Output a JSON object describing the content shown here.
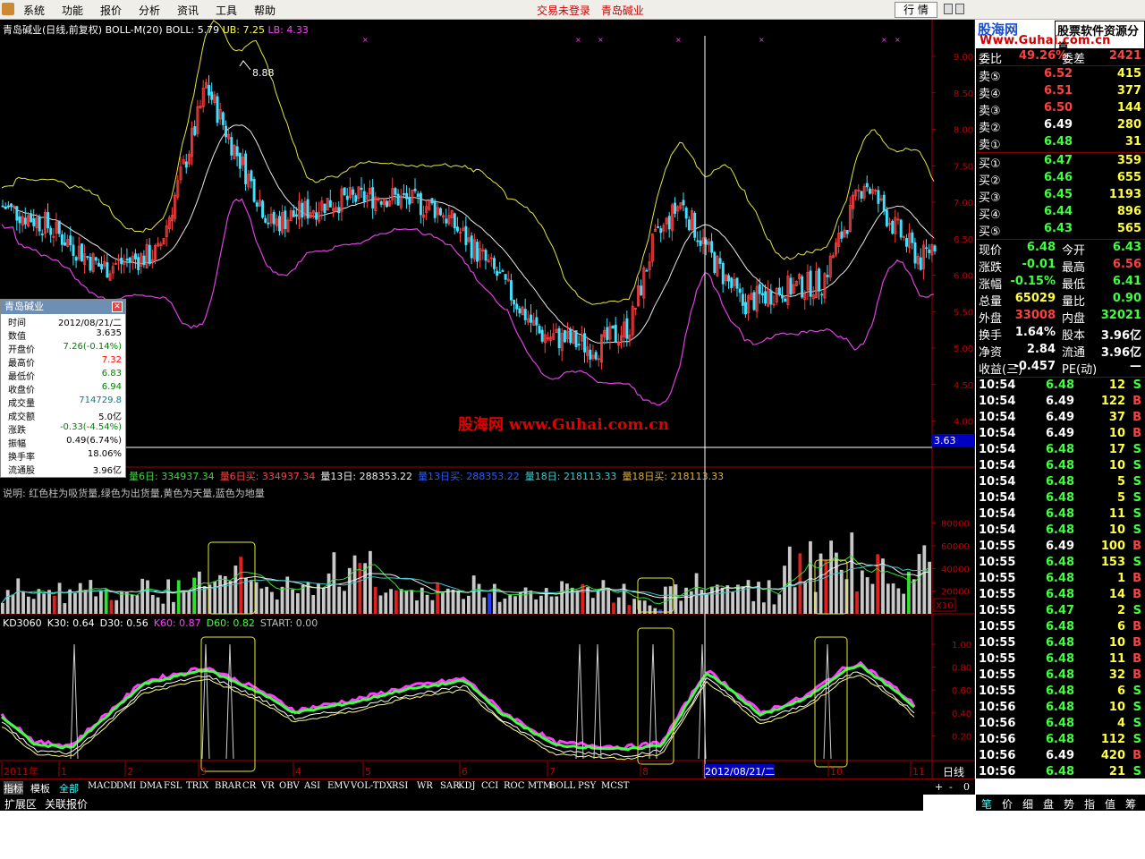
{
  "menu": [
    "系统",
    "功能",
    "报价",
    "分析",
    "资讯",
    "工具",
    "帮助"
  ],
  "center_notice": [
    "交易未登录",
    "青岛碱业"
  ],
  "quote_button": "行 情",
  "main_header": {
    "name": "青岛碱业(日线,前复权)",
    "indicator": "BOLL-M(20)",
    "boll": "BOLL: 5.79",
    "ub": "UB: 7.25",
    "lb": "LB: 4.33"
  },
  "y_axis_price": [
    "9.00",
    "8.50",
    "8.00",
    "7.50",
    "7.00",
    "6.50",
    "6.00",
    "5.50",
    "5.00",
    "4.50",
    "4.00"
  ],
  "crosshair_price": "3.63",
  "max_label": "8.88",
  "watermark": "股海网  www.Guhai.com.cn",
  "volume_header": [
    {
      "text": "量6日: 334937.34",
      "color": "#46d246"
    },
    {
      "text": "量6日买: 334937.34",
      "color": "#ff4040"
    },
    {
      "text": "量13日: 288353.22",
      "color": "#f0f0f0"
    },
    {
      "text": "量13日买: 288353.22",
      "color": "#2a5bff"
    },
    {
      "text": "量18日: 218113.33",
      "color": "#3fc7c7"
    },
    {
      "text": "量18日买: 218113.33",
      "color": "#e0b040"
    }
  ],
  "volume_note": "说明: 红色柱为吸货量,绿色为出货量,黄色为天量,蓝色为地量",
  "y_axis_volume": [
    "80000",
    "60000",
    "40000",
    "20000"
  ],
  "volume_unit": "X10",
  "kd_header": [
    {
      "text": "KD3060",
      "color": "#ffffff"
    },
    {
      "text": "K30: 0.64",
      "color": "#ffffff"
    },
    {
      "text": "D30: 0.56",
      "color": "#ffffff"
    },
    {
      "text": "K60: 0.87",
      "color": "#ff40ff"
    },
    {
      "text": "D60: 0.82",
      "color": "#40ff40"
    },
    {
      "text": "START: 0.00",
      "color": "#c0c0c0"
    }
  ],
  "y_axis_kd": [
    "1.00",
    "0.80",
    "0.60",
    "0.40",
    "0.20"
  ],
  "date_axis": [
    "2011年",
    "1",
    "2",
    "3",
    "4",
    "5",
    "6",
    "7",
    "8",
    "2012/08/21/二",
    "10",
    "11"
  ],
  "period": "日线",
  "tab_controls": [
    "+",
    "-",
    "0"
  ],
  "indicator_tabs": [
    "指标",
    "模板",
    "全部",
    "MACD",
    "DMI",
    "DMA",
    "FSL",
    "TRIX",
    "BRAR",
    "CR",
    "VR",
    "OBV",
    "ASI",
    "EMV",
    "VOL-TDX",
    "RSI",
    "WR",
    "SAR",
    "KDJ",
    "CCI",
    "ROC",
    "MTM",
    "BOLL",
    "PSY",
    "MCST"
  ],
  "bottom_tabs": [
    "扩展区",
    "关联报价"
  ],
  "right_tabs": [
    "笔",
    "价",
    "细",
    "盘",
    "势",
    "指",
    "值",
    "筹"
  ],
  "popup": {
    "title": "青岛碱业",
    "rows": [
      {
        "label": "时间",
        "value": "2012/08/21/二",
        "color": "#000000"
      },
      {
        "label": "数值",
        "value": "3.635",
        "color": "#000000"
      },
      {
        "label": "开盘价",
        "value": "7.26(-0.14%)",
        "color": "#008000"
      },
      {
        "label": "最高价",
        "value": "7.32",
        "color": "#ff0000"
      },
      {
        "label": "最低价",
        "value": "6.83",
        "color": "#008000"
      },
      {
        "label": "收盘价",
        "value": "6.94",
        "color": "#008000"
      },
      {
        "label": "成交量",
        "value": "714729.8",
        "color": "#008080"
      },
      {
        "label": "成交额",
        "value": "5.0亿",
        "color": "#000000"
      },
      {
        "label": "涨跌",
        "value": "-0.33(-4.54%)",
        "color": "#008000"
      },
      {
        "label": "振幅",
        "value": "0.49(6.74%)",
        "color": "#000000"
      },
      {
        "label": "换手率",
        "value": "18.06%",
        "color": "#000000"
      },
      {
        "label": "流通股",
        "value": "3.96亿",
        "color": "#000000"
      }
    ]
  },
  "brand": {
    "name": "股海网",
    "slogan": "股票软件资源分享",
    "url": "Www.Guhai.com.cn"
  },
  "order_book": {
    "ratio": {
      "label": "委比",
      "value": "49.26%",
      "diff_label": "委差",
      "diff": "2421"
    },
    "sells": [
      {
        "label": "卖⑤",
        "price": "6.52",
        "vol": "415",
        "pc": "#ff4040"
      },
      {
        "label": "卖④",
        "price": "6.51",
        "vol": "377",
        "pc": "#ff4040"
      },
      {
        "label": "卖③",
        "price": "6.50",
        "vol": "144",
        "pc": "#ff4040"
      },
      {
        "label": "卖②",
        "price": "6.49",
        "vol": "280",
        "pc": "#ffffff"
      },
      {
        "label": "卖①",
        "price": "6.48",
        "vol": "31",
        "pc": "#40ff40"
      }
    ],
    "buys": [
      {
        "label": "买①",
        "price": "6.47",
        "vol": "359",
        "pc": "#40ff40"
      },
      {
        "label": "买②",
        "price": "6.46",
        "vol": "655",
        "pc": "#40ff40"
      },
      {
        "label": "买③",
        "price": "6.45",
        "vol": "1193",
        "pc": "#40ff40"
      },
      {
        "label": "买④",
        "price": "6.44",
        "vol": "896",
        "pc": "#40ff40"
      },
      {
        "label": "买⑤",
        "price": "6.43",
        "vol": "565",
        "pc": "#40ff40"
      }
    ]
  },
  "stats": [
    {
      "l1": "现价",
      "v1": "6.48",
      "c1": "#40ff40",
      "l2": "今开",
      "v2": "6.43",
      "c2": "#40ff40"
    },
    {
      "l1": "涨跌",
      "v1": "-0.01",
      "c1": "#40ff40",
      "l2": "最高",
      "v2": "6.56",
      "c2": "#ff4040"
    },
    {
      "l1": "涨幅",
      "v1": "-0.15%",
      "c1": "#40ff40",
      "l2": "最低",
      "v2": "6.41",
      "c2": "#40ff40"
    },
    {
      "l1": "总量",
      "v1": "65029",
      "c1": "#ffff40",
      "l2": "量比",
      "v2": "0.90",
      "c2": "#40ff40"
    },
    {
      "l1": "外盘",
      "v1": "33008",
      "c1": "#ff4040",
      "l2": "内盘",
      "v2": "32021",
      "c2": "#40ff40"
    },
    {
      "l1": "换手",
      "v1": "1.64%",
      "c1": "#ffffff",
      "l2": "股本",
      "v2": "3.96亿",
      "c2": "#ffffff"
    },
    {
      "l1": "净资",
      "v1": "2.84",
      "c1": "#ffffff",
      "l2": "流通",
      "v2": "3.96亿",
      "c2": "#ffffff"
    },
    {
      "l1": "收益(三)",
      "v1": "-0.457",
      "c1": "#ffffff",
      "l2": "PE(动)",
      "v2": "—",
      "c2": "#ffffff"
    }
  ],
  "ticks": [
    {
      "t": "10:54",
      "p": "6.48",
      "v": "12",
      "s": "S"
    },
    {
      "t": "10:54",
      "p": "6.49",
      "v": "122",
      "s": "B"
    },
    {
      "t": "10:54",
      "p": "6.49",
      "v": "37",
      "s": "B"
    },
    {
      "t": "10:54",
      "p": "6.49",
      "v": "10",
      "s": "B"
    },
    {
      "t": "10:54",
      "p": "6.48",
      "v": "17",
      "s": "S"
    },
    {
      "t": "10:54",
      "p": "6.48",
      "v": "10",
      "s": "S"
    },
    {
      "t": "10:54",
      "p": "6.48",
      "v": "5",
      "s": "S"
    },
    {
      "t": "10:54",
      "p": "6.48",
      "v": "5",
      "s": "S"
    },
    {
      "t": "10:54",
      "p": "6.48",
      "v": "11",
      "s": "S"
    },
    {
      "t": "10:54",
      "p": "6.48",
      "v": "10",
      "s": "S"
    },
    {
      "t": "10:55",
      "p": "6.49",
      "v": "100",
      "s": "B"
    },
    {
      "t": "10:55",
      "p": "6.48",
      "v": "153",
      "s": "S"
    },
    {
      "t": "10:55",
      "p": "6.48",
      "v": "1",
      "s": "B"
    },
    {
      "t": "10:55",
      "p": "6.48",
      "v": "14",
      "s": "B"
    },
    {
      "t": "10:55",
      "p": "6.47",
      "v": "2",
      "s": "S"
    },
    {
      "t": "10:55",
      "p": "6.48",
      "v": "6",
      "s": "B"
    },
    {
      "t": "10:55",
      "p": "6.48",
      "v": "10",
      "s": "B"
    },
    {
      "t": "10:55",
      "p": "6.48",
      "v": "11",
      "s": "B"
    },
    {
      "t": "10:55",
      "p": "6.48",
      "v": "32",
      "s": "B"
    },
    {
      "t": "10:55",
      "p": "6.48",
      "v": "6",
      "s": "S"
    },
    {
      "t": "10:56",
      "p": "6.48",
      "v": "10",
      "s": "S"
    },
    {
      "t": "10:56",
      "p": "6.48",
      "v": "4",
      "s": "S"
    },
    {
      "t": "10:56",
      "p": "6.48",
      "v": "112",
      "s": "S"
    },
    {
      "t": "10:56",
      "p": "6.49",
      "v": "420",
      "s": "B"
    },
    {
      "t": "10:56",
      "p": "6.48",
      "v": "21",
      "s": "S"
    }
  ],
  "colors": {
    "up": "#ff4040",
    "down": "#40e0ff",
    "bg": "#000000",
    "grid": "#800000"
  }
}
